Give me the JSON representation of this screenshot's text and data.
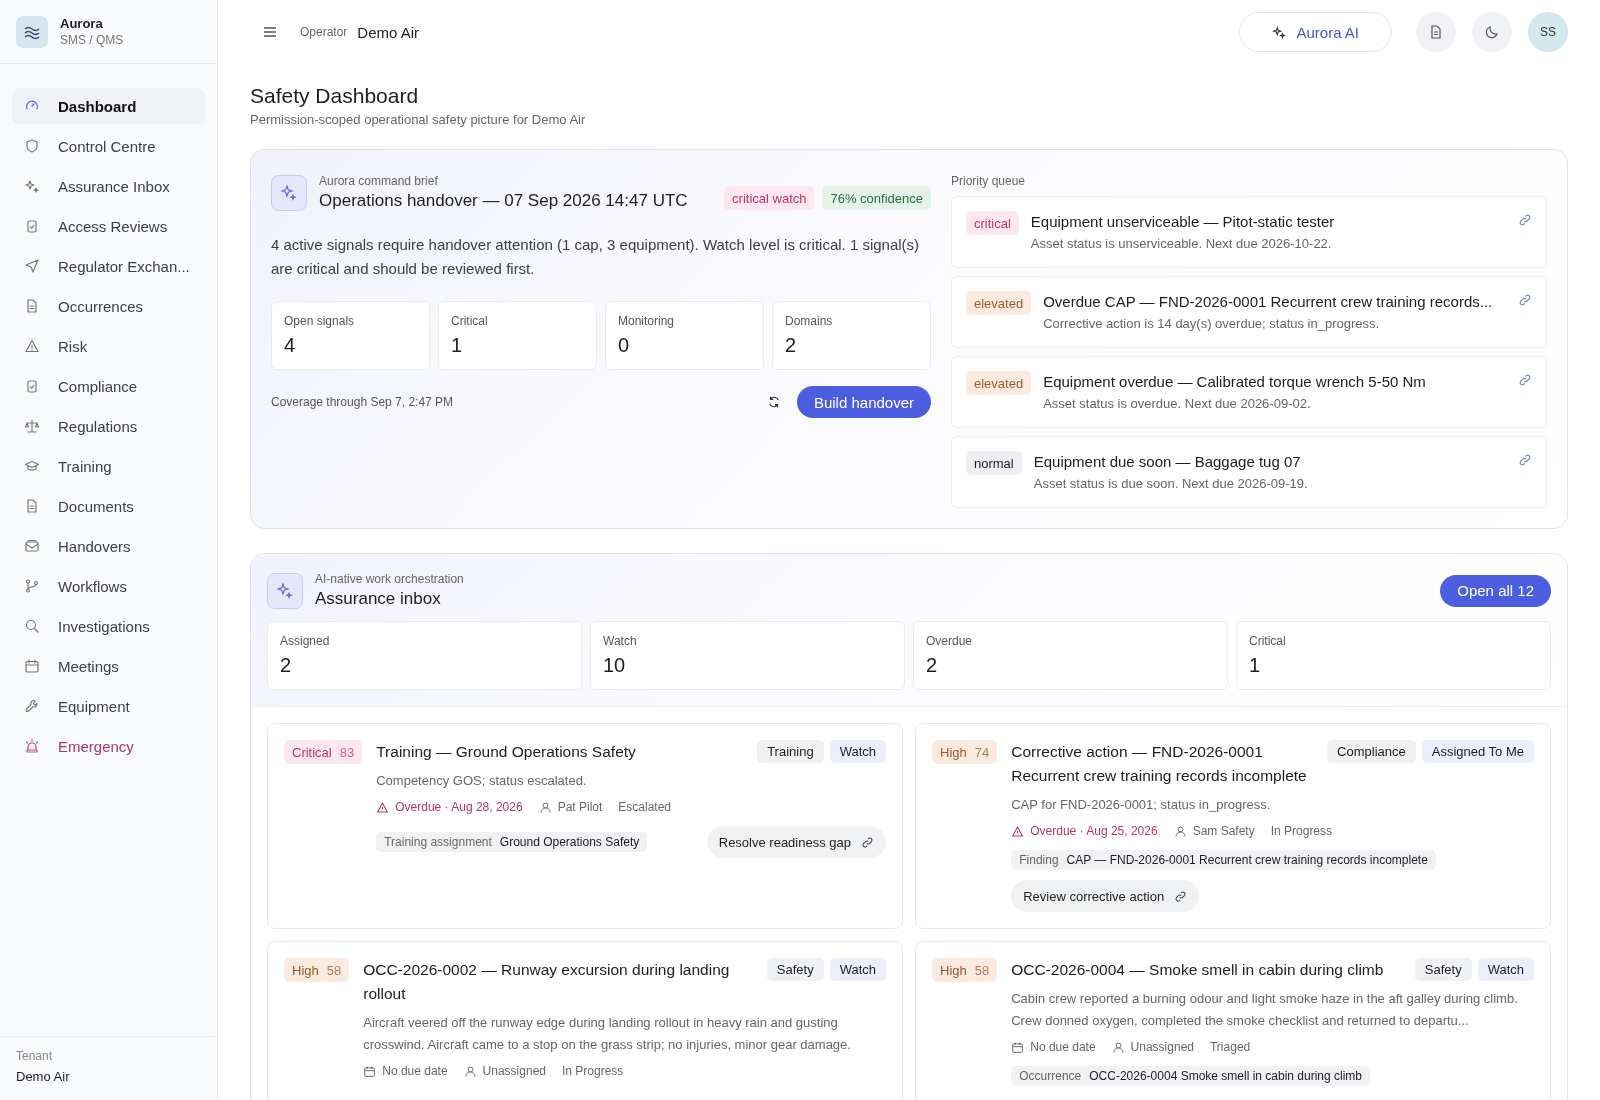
{
  "brand": {
    "name": "Aurora",
    "subtitle": "SMS / QMS"
  },
  "sidebar": {
    "items": [
      {
        "label": "Dashboard",
        "selected": true,
        "kind": "link"
      },
      {
        "label": "Control Centre",
        "selected": false,
        "kind": "link"
      },
      {
        "label": "Assurance Inbox",
        "selected": false,
        "kind": "link"
      },
      {
        "label": "Access Reviews",
        "selected": false,
        "kind": "link"
      },
      {
        "label": "Regulator Exchan...",
        "selected": false,
        "kind": "link"
      },
      {
        "label": "Occurrences",
        "selected": false,
        "kind": "link"
      },
      {
        "label": "Risk",
        "selected": false,
        "kind": "link"
      },
      {
        "label": "Compliance",
        "selected": false,
        "kind": "link"
      },
      {
        "label": "Regulations",
        "selected": false,
        "kind": "link"
      },
      {
        "label": "Training",
        "selected": false,
        "kind": "link"
      },
      {
        "label": "Documents",
        "selected": false,
        "kind": "link"
      },
      {
        "label": "Handovers",
        "selected": false,
        "kind": "link"
      },
      {
        "label": "Workflows",
        "selected": false,
        "kind": "link"
      },
      {
        "label": "Investigations",
        "selected": false,
        "kind": "link"
      },
      {
        "label": "Meetings",
        "selected": false,
        "kind": "link"
      },
      {
        "label": "Equipment",
        "selected": false,
        "kind": "link"
      },
      {
        "label": "Emergency",
        "selected": false,
        "kind": "emergency"
      }
    ],
    "footer": {
      "label": "Tenant",
      "value": "Demo Air"
    }
  },
  "header": {
    "operator_label": "Operator",
    "operator": "Demo Air",
    "ai_button": "Aurora AI",
    "avatar": "SS"
  },
  "page": {
    "title": "Safety Dashboard",
    "subtitle": "Permission-scoped operational safety picture for Demo Air"
  },
  "brief": {
    "eyebrow": "Aurora command brief",
    "title": "Operations handover — 07 Sep 2026 14:47 UTC",
    "badges": [
      {
        "label": "critical watch",
        "kind": "critical"
      },
      {
        "label": "76% confidence",
        "kind": "positive"
      }
    ],
    "summary": "4 active signals require handover attention (1 cap, 3 equipment). Watch level is critical. 1 signal(s) are critical and should be reviewed first.",
    "stats": [
      {
        "label": "Open signals",
        "value": "4"
      },
      {
        "label": "Critical",
        "value": "1"
      },
      {
        "label": "Monitoring",
        "value": "0"
      },
      {
        "label": "Domains",
        "value": "2"
      }
    ],
    "coverage": "Coverage through Sep 7, 2:47 PM",
    "action": "Build handover",
    "queue_title": "Priority queue",
    "queue": [
      {
        "severity": "critical",
        "title": "Equipment unserviceable — Pitot-static tester",
        "detail": "Asset status is unserviceable. Next due 2026-10-22."
      },
      {
        "severity": "elevated",
        "title": "Overdue CAP — FND-2026-0001 Recurrent crew training records...",
        "detail": "Corrective action is 14 day(s) overdue; status in_progress."
      },
      {
        "severity": "elevated",
        "title": "Equipment overdue — Calibrated torque wrench 5-50 Nm",
        "detail": "Asset status is overdue. Next due 2026-09-02."
      },
      {
        "severity": "normal",
        "title": "Equipment due soon — Baggage tug 07",
        "detail": "Asset status is due soon. Next due 2026-09-19."
      }
    ]
  },
  "inbox": {
    "eyebrow": "AI-native work orchestration",
    "title": "Assurance inbox",
    "action": "Open all 12",
    "stats": [
      {
        "label": "Assigned",
        "value": "2"
      },
      {
        "label": "Watch",
        "value": "10"
      },
      {
        "label": "Overdue",
        "value": "2"
      },
      {
        "label": "Critical",
        "value": "1"
      }
    ],
    "items": [
      {
        "priority": "Critical",
        "score": "83",
        "kind": "critical",
        "title": "Training — Ground Operations Safety",
        "tags": [
          {
            "label": "Training",
            "kind": "domain"
          },
          {
            "label": "Watch",
            "kind": "queue"
          }
        ],
        "description": "Competency GOS; status escalated.",
        "due": {
          "text": "Overdue · Aug 28, 2026",
          "overdue": true
        },
        "assignee": "Pat Pilot",
        "status": "Escalated",
        "reference": {
          "label": "Training assignment",
          "value": "Ground Operations Safety"
        },
        "action": "Resolve readiness gap",
        "action_inline": true
      },
      {
        "priority": "High",
        "score": "74",
        "kind": "high",
        "title": "Corrective action — FND-2026-0001 Recurrent crew training records incomplete",
        "tags": [
          {
            "label": "Compliance",
            "kind": "domain"
          },
          {
            "label": "Assigned To Me",
            "kind": "queue"
          }
        ],
        "description": "CAP for FND-2026-0001; status in_progress.",
        "due": {
          "text": "Overdue · Aug 25, 2026",
          "overdue": true
        },
        "assignee": "Sam Safety",
        "status": "In Progress",
        "reference": {
          "label": "Finding",
          "value": "CAP — FND-2026-0001 Recurrent crew training records incomplete"
        },
        "action": "Review corrective action",
        "action_inline": false
      },
      {
        "priority": "High",
        "score": "58",
        "kind": "high",
        "title": "OCC-2026-0002 — Runway excursion during landing rollout",
        "tags": [
          {
            "label": "Safety",
            "kind": "domain"
          },
          {
            "label": "Watch",
            "kind": "queue"
          }
        ],
        "description": "Aircraft veered off the runway edge during landing rollout in heavy rain and gusting crosswind. Aircraft came to a stop on the grass strip; no injuries, minor gear damage.",
        "due": {
          "text": "No due date",
          "overdue": false
        },
        "assignee": "Unassigned",
        "status": "In Progress"
      },
      {
        "priority": "High",
        "score": "58",
        "kind": "high",
        "title": "OCC-2026-0004 — Smoke smell in cabin during climb",
        "tags": [
          {
            "label": "Safety",
            "kind": "domain"
          },
          {
            "label": "Watch",
            "kind": "queue"
          }
        ],
        "description": "Cabin crew reported a burning odour and light smoke haze in the aft galley during climb. Crew donned oxygen, completed the smoke checklist and returned to departu...",
        "due": {
          "text": "No due date",
          "overdue": false
        },
        "assignee": "Unassigned",
        "status": "Triaged",
        "reference": {
          "label": "Occurrence",
          "value": "OCC-2026-0004 Smoke smell in cabin during climb"
        }
      }
    ]
  }
}
